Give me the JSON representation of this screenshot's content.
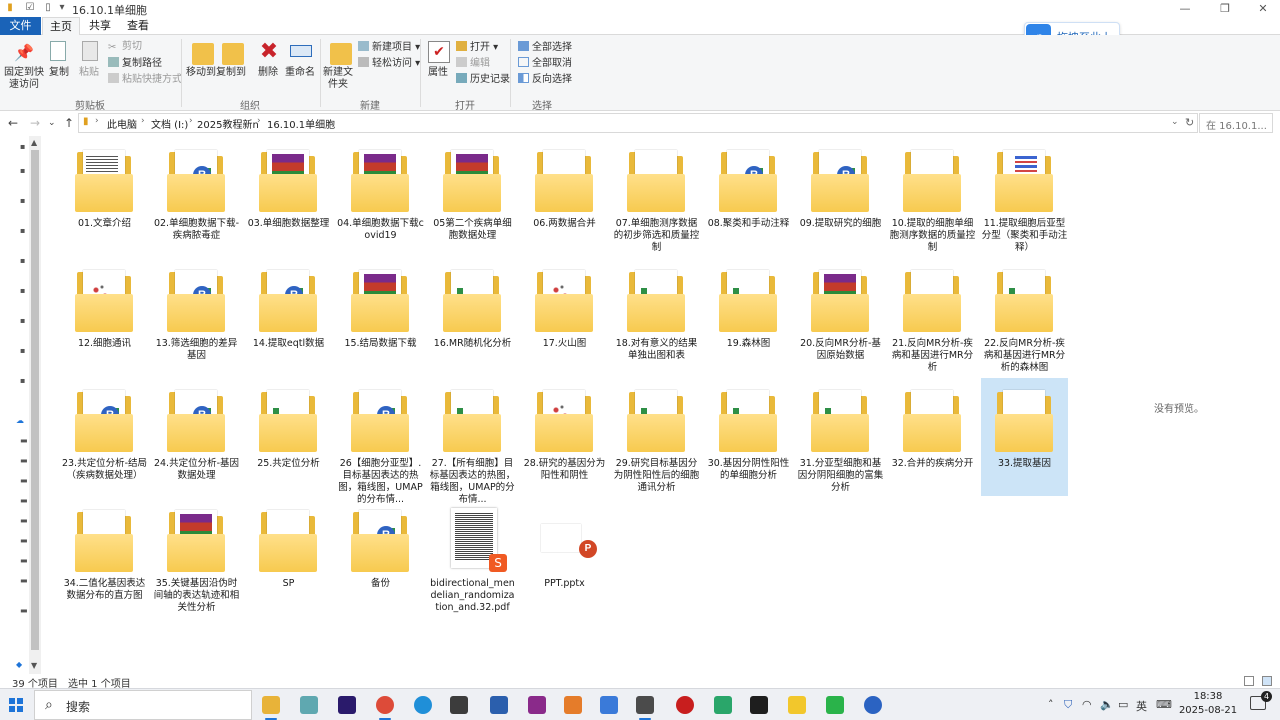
{
  "window": {
    "title": "16.10.1单细胞",
    "tabs": [
      "文件",
      "主页",
      "共享",
      "查看"
    ]
  },
  "upload_button": {
    "label": "拖拽至此上传"
  },
  "ribbon": {
    "clipboard": {
      "pin_label": "固定到快速访问",
      "copy_label": "复制",
      "paste_label": "粘贴",
      "cut_label": "剪切",
      "copy_path_label": "复制路径",
      "paste_shortcut_label": "粘贴快捷方式",
      "group": "剪贴板"
    },
    "organize": {
      "move_label": "移动到",
      "copy_to_label": "复制到",
      "delete_label": "删除",
      "rename_label": "重命名",
      "group": "组织"
    },
    "new": {
      "new_folder_label": "新建文件夹",
      "new_item_label": "新建项目",
      "easy_access_label": "轻松访问",
      "group": "新建"
    },
    "open": {
      "properties_label": "属性",
      "open_label": "打开",
      "edit_label": "编辑",
      "history_label": "历史记录",
      "group": "打开"
    },
    "select": {
      "select_all_label": "全部选择",
      "select_none_label": "全部取消",
      "invert_label": "反向选择",
      "group": "选择"
    }
  },
  "address": {
    "crumbs": [
      "此电脑",
      "文档 (I:)",
      "2025教程新n",
      "16.10.1单细胞"
    ],
    "search_placeholder": "在 16.10.1..."
  },
  "items": [
    {
      "name": "01.文章介绍",
      "kind": "doc"
    },
    {
      "name": "02.单细胞数据下载-疾病脓毒症",
      "kind": "r"
    },
    {
      "name": "03.单细胞数据整理",
      "kind": "rar"
    },
    {
      "name": "04.单细胞数据下载covid19",
      "kind": "rar"
    },
    {
      "name": "05第二个疾病单细胞数据处理",
      "kind": "rar"
    },
    {
      "name": "06.两数据合并",
      "kind": "plain"
    },
    {
      "name": "07.单细胞测序数据的初步筛选和质量控制",
      "kind": "plain"
    },
    {
      "name": "08.聚类和手动注释",
      "kind": "r"
    },
    {
      "name": "09.提取研究的细胞",
      "kind": "r"
    },
    {
      "name": "10.提取的细胞单细胞测序数据的质量控制",
      "kind": "plain"
    },
    {
      "name": "11.提取细胞后亚型分型（聚类和手动注释）",
      "kind": "heat"
    },
    {
      "name": "12.细胞通讯",
      "kind": "dots"
    },
    {
      "name": "13.筛选细胞的差异基因",
      "kind": "r"
    },
    {
      "name": "14.提取eqtl数据",
      "kind": "r"
    },
    {
      "name": "15.结局数据下载",
      "kind": "rar"
    },
    {
      "name": "16.MR随机化分析",
      "kind": "green"
    },
    {
      "name": "17.火山图",
      "kind": "dots"
    },
    {
      "name": "18.对有意义的结果单独出图和表",
      "kind": "green"
    },
    {
      "name": "19.森林图",
      "kind": "green"
    },
    {
      "name": "20.反向MR分析-基因原始数据",
      "kind": "rar"
    },
    {
      "name": "21.反向MR分析-疾病和基因进行MR分析",
      "kind": "plain"
    },
    {
      "name": "22.反向MR分析-疾病和基因进行MR分析的森林图",
      "kind": "green"
    },
    {
      "name": "23.共定位分析-结局（疾病数据处理）",
      "kind": "r"
    },
    {
      "name": "24.共定位分析-基因数据处理",
      "kind": "r"
    },
    {
      "name": "25.共定位分析",
      "kind": "green"
    },
    {
      "name": "26【细胞分亚型】.目标基因表达的热图，箱线图，UMAP的分布情...",
      "kind": "r"
    },
    {
      "name": "27.【所有细胞】目标基因表达的热图，箱线图，UMAP的分布情...",
      "kind": "green"
    },
    {
      "name": "28.研究的基因分为阳性和阴性",
      "kind": "dots"
    },
    {
      "name": "29.研究目标基因分为阴性阳性后的细胞通讯分析",
      "kind": "green"
    },
    {
      "name": "30.基因分阴性阳性的单细胞分析",
      "kind": "green"
    },
    {
      "name": "31.分亚型细胞和基因分阴阳细胞的富集分析",
      "kind": "green"
    },
    {
      "name": "32.合并的疾病分开",
      "kind": "plain"
    },
    {
      "name": "33.提取基因",
      "kind": "plain",
      "selected": true
    },
    {
      "name": "34.二值化基因表达数据分布的直方图",
      "kind": "plain"
    },
    {
      "name": "35.关键基因沿伪时间轴的表达轨迹和相关性分析",
      "kind": "rar"
    },
    {
      "name": "SP",
      "kind": "plain"
    },
    {
      "name": "备份",
      "kind": "r"
    },
    {
      "name": "bidirectional_mendelian_randomization_and.32.pdf",
      "kind": "pdf"
    },
    {
      "name": "PPT.pptx",
      "kind": "ppt"
    }
  ],
  "preview": {
    "text": "没有预览。"
  },
  "status": {
    "count": "39 个项目",
    "selected": "选中 1 个项目"
  },
  "taskbar": {
    "search_placeholder": "搜索",
    "time": "18:38",
    "date": "2025-08-21",
    "notif_count": "4",
    "apps": [
      "file-explorer",
      "tablet-app",
      "premiere",
      "chrome",
      "edge",
      "pycharm",
      "r-studio",
      "3d-app",
      "sublime",
      "feishu",
      "terminal-app",
      "record-app",
      "monitor-app",
      "console-app",
      "norton-app",
      "wechat",
      "r-app"
    ],
    "accent": "#1e74d8"
  }
}
